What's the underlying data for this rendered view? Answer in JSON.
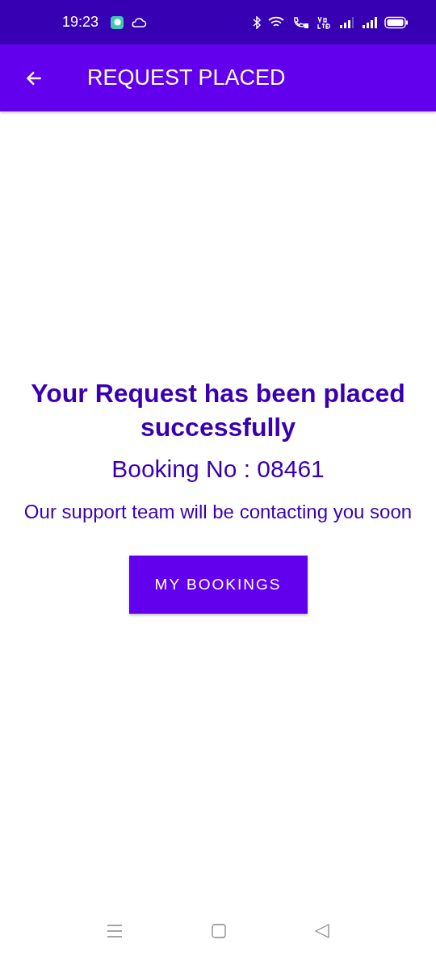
{
  "status_bar": {
    "time": "19:23"
  },
  "app_bar": {
    "title": "REQUEST PLACED"
  },
  "message": {
    "heading": "Your Request has been placed successfully",
    "booking": "Booking No : 08461",
    "note": "Our support team will be contacting you soon"
  },
  "button": {
    "label": "MY BOOKINGS"
  }
}
